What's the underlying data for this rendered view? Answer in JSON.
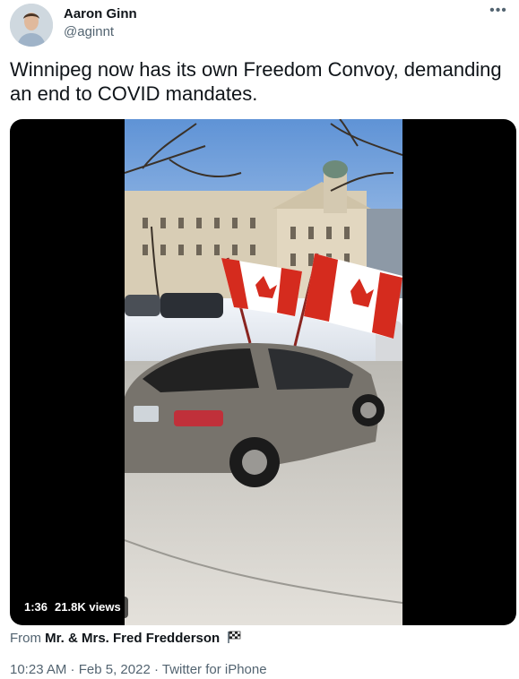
{
  "author": {
    "name": "Aaron Ginn",
    "handle": "@aginnt"
  },
  "more_label": "•••",
  "tweet_text": "Winnipeg now has its own Freedom Convoy, demanding an end to COVID mandates.",
  "video": {
    "duration": "1:36",
    "views": "21.8K views"
  },
  "source": {
    "prefix": "From",
    "name": "Mr. & Mrs. Fred Fredderson"
  },
  "meta": {
    "time": "10:23 AM",
    "date": "Feb 5, 2022",
    "client": "Twitter for iPhone",
    "separator": " · "
  },
  "colors": {
    "text": "#0f1419",
    "secondary": "#536471",
    "flag_red": "#d52b1e"
  }
}
